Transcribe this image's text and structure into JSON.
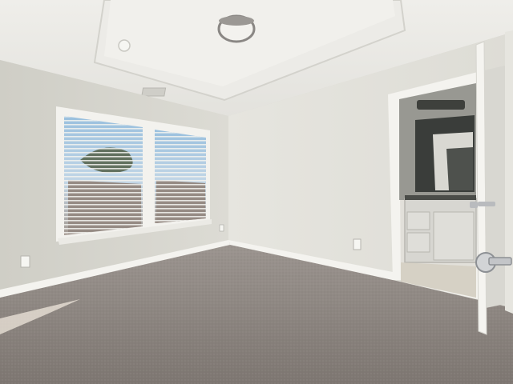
{
  "scene": {
    "description_free": true,
    "palette": {
      "ceiling": "#e9e8e4",
      "left_wall": "#d6d5cd",
      "back_wall": "#e2e1db",
      "carpet": "#8c8580",
      "trim": "#f4f3ef",
      "sky": "#9dc3e0"
    }
  }
}
